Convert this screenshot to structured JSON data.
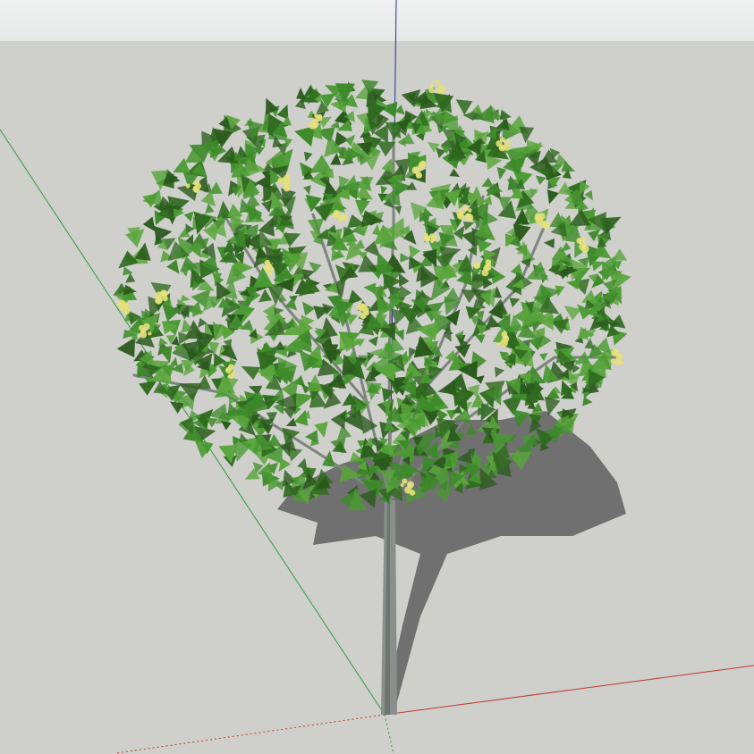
{
  "viewport": {
    "sky_color": "#eceeee",
    "ground_color": "#cfcfcb",
    "axis_colors": {
      "x": "#c0392b",
      "y": "#2e9e3a",
      "z": "#2c2ca8"
    }
  },
  "model": {
    "leaf_colors": [
      "#2f6b1f",
      "#3d8a2a",
      "#4a9a33",
      "#2a5a1c",
      "#5aa53c"
    ],
    "flower_color": "#e4e07a",
    "shadow_color": "#707070",
    "trunk_color": "#8a8f8c"
  }
}
